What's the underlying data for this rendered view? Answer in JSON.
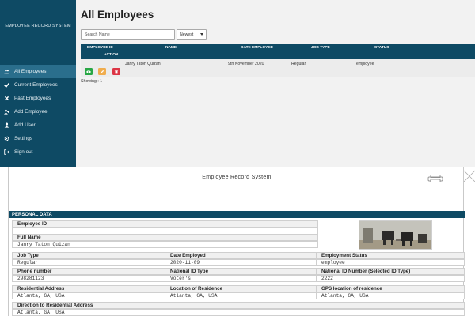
{
  "sidebar": {
    "brand": "EMPLOYEE RECORD SYSTEM",
    "items": [
      {
        "label": "All Employees",
        "icon": "users-icon"
      },
      {
        "label": "Current Employees",
        "icon": "check-icon"
      },
      {
        "label": "Past Employees",
        "icon": "x-icon"
      },
      {
        "label": "Add Employee",
        "icon": "user-plus-icon"
      },
      {
        "label": "Add User",
        "icon": "user-icon"
      },
      {
        "label": "Settings",
        "icon": "gear-icon"
      },
      {
        "label": "Sign out",
        "icon": "sign-out-icon"
      }
    ]
  },
  "main": {
    "title": "All Employees",
    "search_placeholder": "Search Name",
    "sort_selected": "Newest",
    "table": {
      "headers": [
        "EMPLOYEE ID",
        "NAME",
        "DATE EMPLOYED",
        "JOB TYPE",
        "STATUS",
        "ACTION"
      ],
      "rows": [
        {
          "employee_id": "",
          "name": "Janry Taton Quizan",
          "date_employed": "9th November 2020",
          "job_type": "Regular",
          "status": "employee"
        }
      ]
    },
    "showing": "Showing : 1",
    "action_colors": {
      "view": "#28a745",
      "edit": "#f0ad4e",
      "delete": "#dc3545"
    }
  },
  "document": {
    "title": "Employee Record System",
    "section": "PERSONAL DATA",
    "fields": {
      "employee_id": {
        "label": "Employee ID",
        "value": ""
      },
      "full_name": {
        "label": "Full Name",
        "value": "Janry Taton Quizan"
      },
      "job_type": {
        "label": "Job Type",
        "value": "Regular"
      },
      "date_employed": {
        "label": "Date Employed",
        "value": "2020-11-09"
      },
      "employment_status": {
        "label": "Employment Status",
        "value": "employee"
      },
      "phone": {
        "label": "Phone number",
        "value": "298281123"
      },
      "national_id_type": {
        "label": "National ID Type",
        "value": "Voter's"
      },
      "national_id_number": {
        "label": "National ID Number (Selected ID Type)",
        "value": "2222"
      },
      "residential_address": {
        "label": "Residential Address",
        "value": "Atlanta, GA, USA"
      },
      "location_of_residence": {
        "label": "Location of Residence",
        "value": "Atlanta, GA, USA"
      },
      "gps_location": {
        "label": "GPS location of residence",
        "value": "Atlanta, GA, USA"
      },
      "direction": {
        "label": "Direction to Residential Address",
        "value": "Atlanta, GA, USA"
      }
    }
  },
  "colors": {
    "brand": "#0e4a64",
    "active_nav": "#2a6e8c"
  }
}
